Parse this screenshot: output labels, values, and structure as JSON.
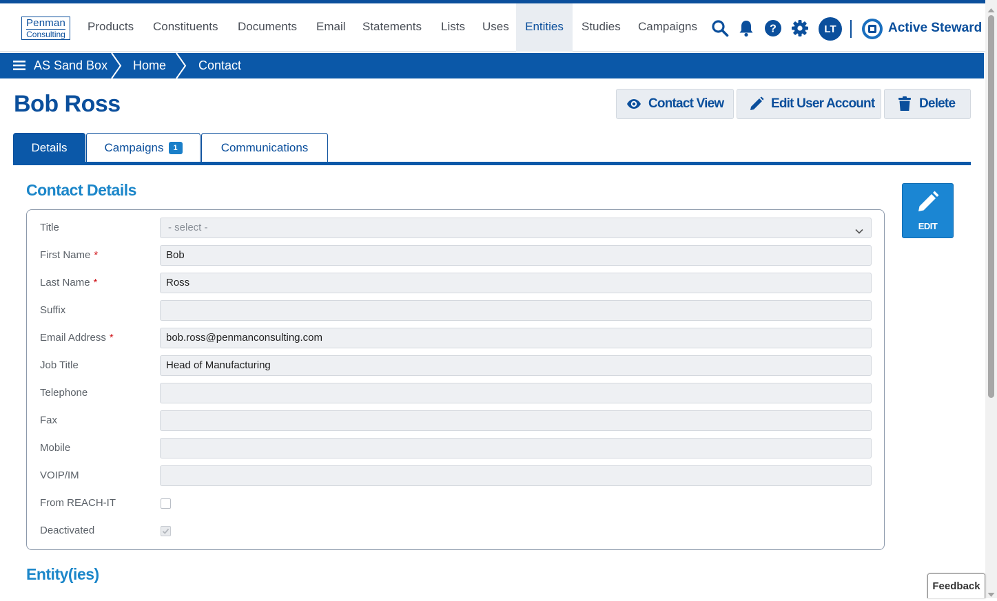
{
  "colors": {
    "brand": "#0b4f9c",
    "breadcrumb_bg": "#0b58a8",
    "section_title": "#1b86c9",
    "edit_button": "#1b86d3",
    "required": "#d0141a"
  },
  "logo": {
    "line1": "Penman",
    "line2": "Consulting"
  },
  "nav": {
    "items": [
      "Products",
      "Constituents",
      "Documents",
      "Email",
      "Statements",
      "Lists",
      "Uses",
      "Entities",
      "Studies",
      "Campaigns"
    ],
    "active": "Entities",
    "icons": [
      "search-icon",
      "bell-icon",
      "help-icon",
      "gear-icon"
    ],
    "avatar_initials": "LT",
    "brand_name": "Active Steward"
  },
  "breadcrumb": {
    "root": "AS Sand Box",
    "items": [
      "Home",
      "Contact"
    ]
  },
  "page": {
    "title": "Bob Ross",
    "actions": {
      "contact_view": "Contact View",
      "edit_user_account": "Edit User Account",
      "delete": "Delete"
    }
  },
  "tabs": [
    {
      "label": "Details",
      "active": true
    },
    {
      "label": "Campaigns",
      "badge": "1",
      "active": false
    },
    {
      "label": "Communications",
      "active": false
    }
  ],
  "contact_details": {
    "heading": "Contact Details",
    "edit_label": "EDIT",
    "fields": {
      "title": {
        "label": "Title",
        "value": "- select -"
      },
      "first_name": {
        "label": "First Name",
        "value": "Bob",
        "required": "*"
      },
      "last_name": {
        "label": "Last Name",
        "value": "Ross",
        "required": "*"
      },
      "suffix": {
        "label": "Suffix",
        "value": ""
      },
      "email": {
        "label": "Email Address",
        "value": "bob.ross@penmanconsulting.com",
        "required": "*"
      },
      "job_title": {
        "label": "Job Title",
        "value": "Head of Manufacturing"
      },
      "telephone": {
        "label": "Telephone",
        "value": ""
      },
      "fax": {
        "label": "Fax",
        "value": ""
      },
      "mobile": {
        "label": "Mobile",
        "value": ""
      },
      "voip": {
        "label": "VOIP/IM",
        "value": ""
      },
      "from_reach_it": {
        "label": "From REACH-IT",
        "checked": false
      },
      "deactivated": {
        "label": "Deactivated",
        "checked": true
      }
    }
  },
  "entities": {
    "heading": "Entity(ies)"
  },
  "feedback": {
    "label": "Feedback"
  }
}
